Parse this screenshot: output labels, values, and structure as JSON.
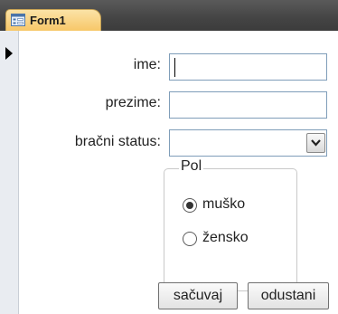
{
  "window": {
    "tab_title": "Form1",
    "tab_icon": "form-icon",
    "record_selector_icon": "current-record-arrow-icon"
  },
  "form": {
    "ime": {
      "label": "ime:",
      "value": ""
    },
    "prezime": {
      "label": "prezime:",
      "value": ""
    },
    "bracni_status": {
      "label": "bračni status:",
      "value": "",
      "dropdown_icon": "chevron-down-icon"
    },
    "pol": {
      "title": "Pol",
      "options": [
        {
          "label": "muško",
          "selected": true
        },
        {
          "label": "žensko",
          "selected": false
        }
      ]
    },
    "buttons": {
      "save": "sačuvaj",
      "cancel": "odustani"
    }
  }
}
